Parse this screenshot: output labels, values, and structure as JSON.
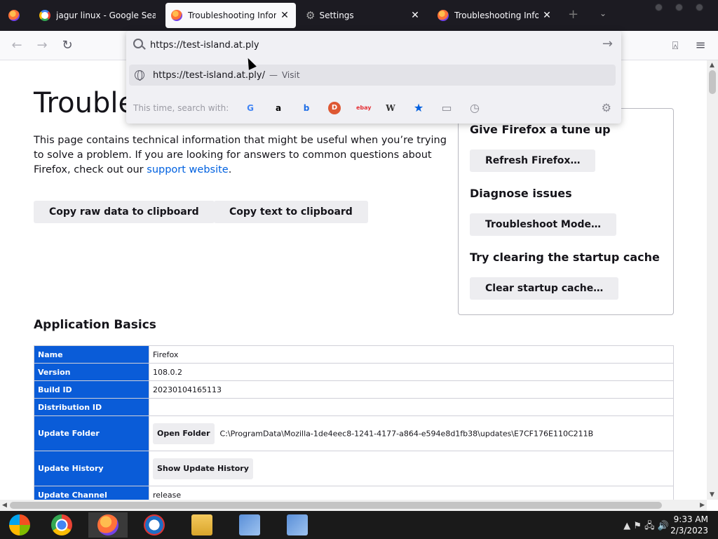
{
  "tabs": [
    {
      "title": "jagur linux - Google Search",
      "icon": "google-icon"
    },
    {
      "title": "Troubleshooting Information",
      "icon": "firefox-icon",
      "active": true
    },
    {
      "title": "Settings",
      "icon": "gear-icon"
    },
    {
      "title": "Troubleshooting Information",
      "icon": "firefox-icon"
    }
  ],
  "navbar": {
    "back": "←",
    "forward": "→",
    "reload": "↻",
    "new_tab": "+",
    "list_tabs": "⌄",
    "pocket": "⍓",
    "menu": "≡"
  },
  "url": {
    "value": "https://test-island.at.ply",
    "go": "→",
    "suggestion": "https://test-island.at.ply/",
    "suggestion_sep": "—",
    "suggestion_action": "Visit",
    "search_with_label": "This time, search with:",
    "engines": [
      "google",
      "amazon",
      "bing",
      "duckduckgo",
      "ebay",
      "wikipedia",
      "bookmarks",
      "tabs",
      "history"
    ],
    "engine_glyphs": {
      "google": "G",
      "amazon": "a",
      "bing": "b",
      "duckduckgo": "D",
      "ebay": "ebay",
      "wikipedia": "W",
      "bookmarks": "★",
      "tabs": "▭",
      "history": "◷"
    },
    "settings": "⚙"
  },
  "page": {
    "title": "Troubleshooting Information",
    "intro_text": "This page contains technical information that might be useful when you’re trying to solve a problem. If you are looking for answers to common questions about Firefox, check out our ",
    "support_link": "support website",
    "intro_end": ".",
    "copy_raw": "Copy raw data to clipboard",
    "copy_text": "Copy text to clipboard",
    "sidebox": {
      "tune_heading": "Give Firefox a tune up",
      "refresh_btn": "Refresh Firefox…",
      "diagnose_heading": "Diagnose issues",
      "troubleshoot_btn": "Troubleshoot Mode…",
      "cache_heading": "Try clearing the startup cache",
      "cache_btn": "Clear startup cache…"
    },
    "section_heading": "Application Basics",
    "rows": {
      "name": {
        "label": "Name",
        "value": "Firefox"
      },
      "version": {
        "label": "Version",
        "value": "108.0.2"
      },
      "build": {
        "label": "Build ID",
        "value": "20230104165113"
      },
      "distribution": {
        "label": "Distribution ID",
        "value": ""
      },
      "update_folder": {
        "label": "Update Folder",
        "button": "Open Folder",
        "value": "C:\\ProgramData\\Mozilla-1de4eec8-1241-4177-a864-e594e8d1fb38\\updates\\E7CF176E110C211B"
      },
      "update_history": {
        "label": "Update History",
        "button": "Show Update History"
      },
      "update_channel": {
        "label": "Update Channel",
        "value": "release"
      }
    }
  },
  "taskbar": {
    "apps": [
      "start-orb",
      "chrome",
      "firefox",
      "ie",
      "explorer",
      "network-app-1",
      "network-app-2"
    ],
    "tray": "▲  ⚑  🖧  🔊",
    "time": "9:33 AM",
    "date": "2/3/2023"
  },
  "colors": {
    "accent": "#0a5cd8",
    "link": "#0061e0",
    "tabbar": "#1c1b22"
  }
}
